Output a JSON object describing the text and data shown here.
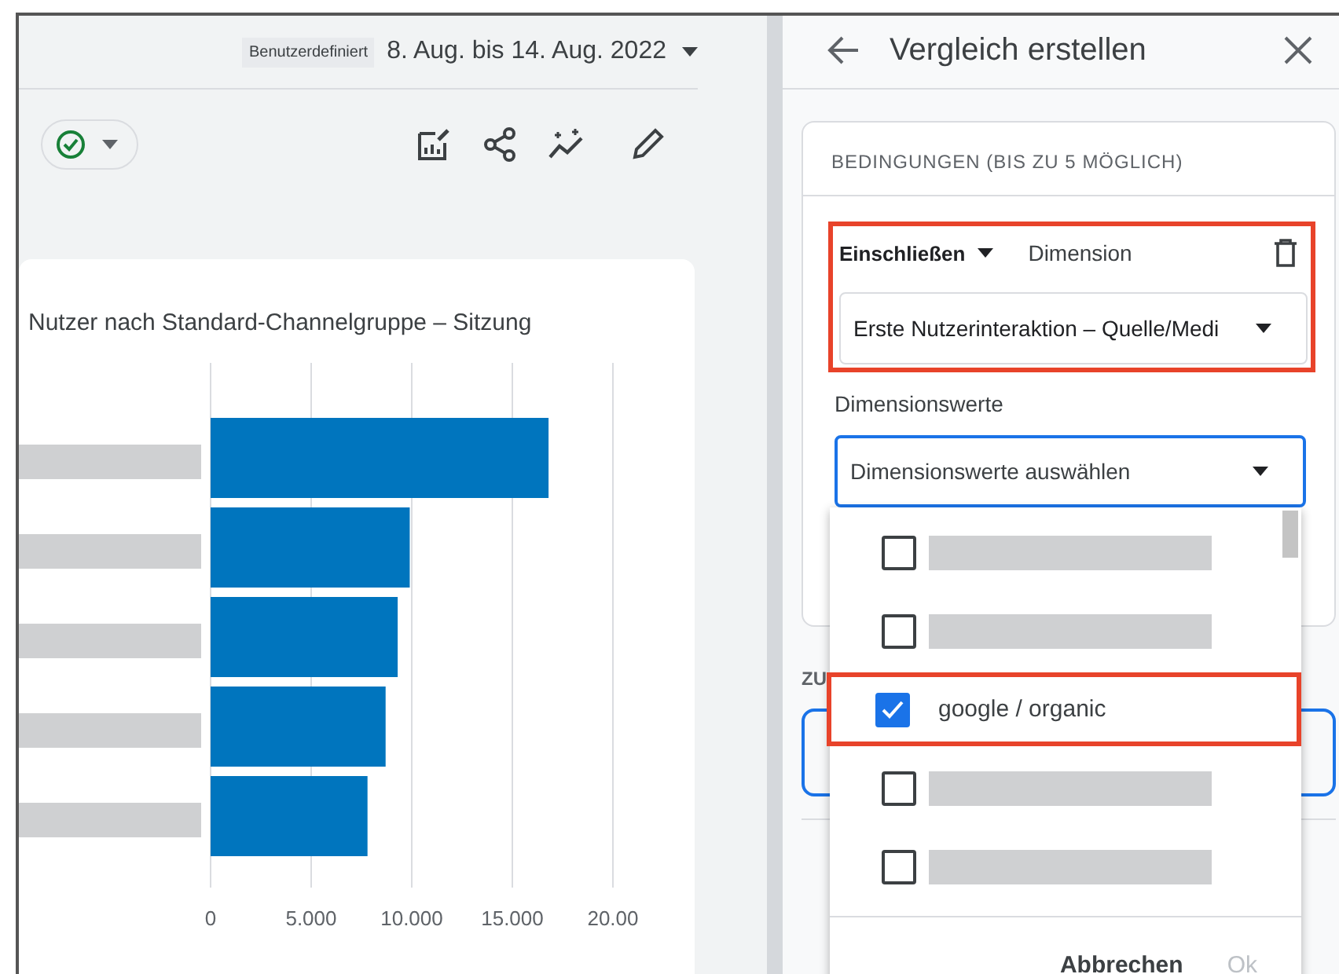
{
  "header": {
    "range_badge": "Benutzerdefiniert",
    "date_range": "8. Aug. bis 14. Aug. 2022"
  },
  "chart": {
    "title": "Nutzer nach Standard-Channelgruppe – Sitzung",
    "chart_data": {
      "type": "bar",
      "orientation": "horizontal",
      "grid": true,
      "xlim": [
        0,
        20
      ],
      "xticks": [
        0,
        {
          "value": 5,
          "label": "5.000"
        },
        {
          "value": 10,
          "label": "10.000"
        },
        {
          "value": 15,
          "label": "15.000"
        },
        {
          "value": 20,
          "label": "20.00"
        }
      ],
      "series": [
        {
          "color": "#0075be",
          "values": [
            16.8,
            9.9,
            9.3,
            8.7,
            7.8
          ]
        }
      ]
    }
  },
  "panel": {
    "title": "Vergleich erstellen",
    "conditions_heading": "BEDINGUNGEN (BIS ZU 5 MÖGLICH)",
    "condition": {
      "highlighted": true,
      "mode": "Einschließen",
      "label": "Dimension",
      "dimension": "Erste Nutzerinteraktion – Quelle/Medi"
    },
    "values_label": "Dimensionswerte",
    "values_field": {
      "placeholder": "Dimensionswerte auswählen"
    },
    "next_section_label": "ZU",
    "dropdown": {
      "options": [
        {
          "kind": "redacted",
          "checked": false,
          "highlighted": false
        },
        {
          "kind": "redacted",
          "checked": false,
          "highlighted": false
        },
        {
          "kind": "text",
          "label": "google / organic",
          "checked": true,
          "highlighted": true
        },
        {
          "kind": "redacted",
          "checked": false,
          "highlighted": false
        },
        {
          "kind": "redacted",
          "checked": false,
          "highlighted": false
        }
      ],
      "buttons": [
        {
          "label": "Abbrechen",
          "disabled": false
        },
        {
          "label": "Ok",
          "disabled": true
        }
      ]
    }
  }
}
